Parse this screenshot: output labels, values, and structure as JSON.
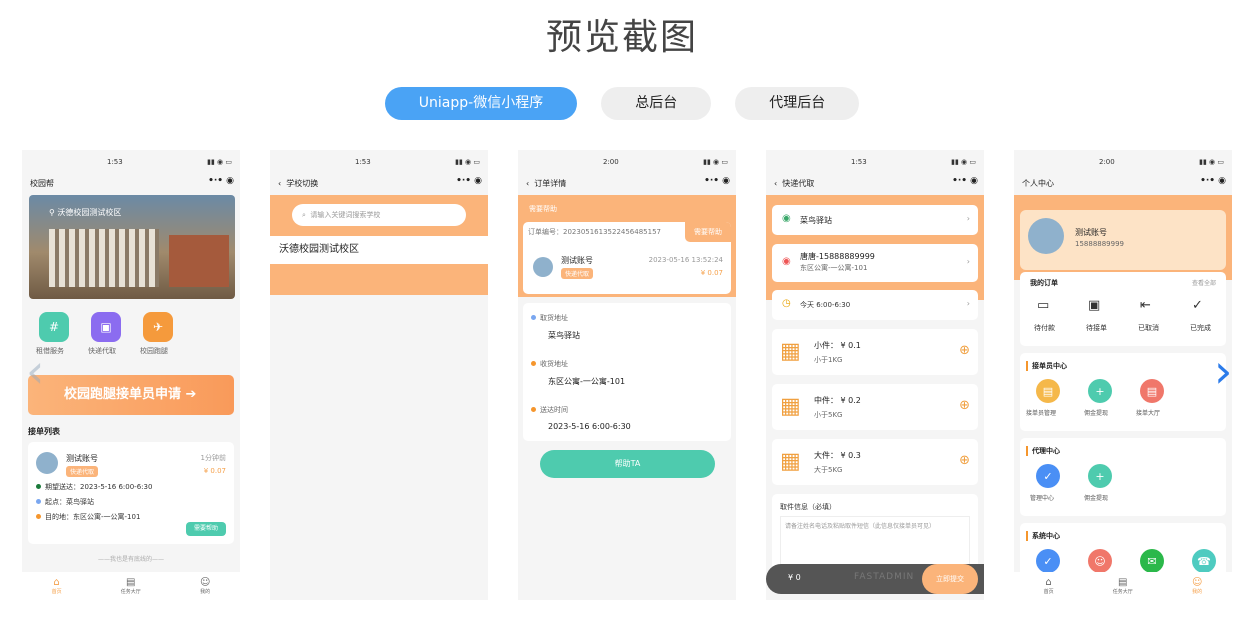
{
  "heading": "预览截图",
  "tabs": [
    "Uniapp-微信小程序",
    "总后台",
    "代理后台"
  ],
  "status": {
    "p1": "1:53",
    "p2": "1:53",
    "p3": "2:00",
    "p4": "1:53",
    "p5": "2:00"
  },
  "p1": {
    "nav": "校园帮",
    "banner_location": "沃德校园测试校区",
    "services": [
      "租借服务",
      "快递代取",
      "校园跑腿"
    ],
    "apply": "校园跑腿接单员申请",
    "list_title": "接单列表",
    "order": {
      "name": "测试账号",
      "time": "1分钟前",
      "tag": "快递代取",
      "price": "¥ 0.07",
      "expect": "期望送达：2023-5-16 6:00-6:30",
      "from": "起点：菜鸟驿站",
      "to": "目的地：东区公寓-一公寓-101",
      "btn": "需要帮助"
    },
    "bottom_note": "——我也是有底线的——",
    "tabbar": [
      "首页",
      "任务大厅",
      "我的"
    ]
  },
  "p2": {
    "nav": "学校切换",
    "search_placeholder": "请输入关键词搜索学校",
    "school": "沃德校园测试校区"
  },
  "p3": {
    "nav": "订单详情",
    "status": "需要帮助",
    "order_no": "订单编号：20230516135224564851​57",
    "order_badge": "需要帮助",
    "name": "测试账号",
    "time": "2023-05-16 13:52:24",
    "tag": "快递代取",
    "price": "¥ 0.07",
    "pickup_label": "取货地址",
    "pickup": "菜鸟驿站",
    "receive_label": "收货地址",
    "receive": "东区公寓-一公寓-101",
    "time_label": "送达时间",
    "deliver": "2023-5-16 6:00-6:30",
    "btn": "帮助TA"
  },
  "p4": {
    "nav": "快递代取",
    "station": "菜鸟驿站",
    "contact": "唐唐-15888889999",
    "address": "东区公寓-一公寓-101",
    "time": "今天 6:00-6:30",
    "items": [
      {
        "name": "小件：  ¥ 0.1",
        "desc": "小于1KG"
      },
      {
        "name": "中件：  ¥ 0.2",
        "desc": "小于5KG"
      },
      {
        "name": "大件：  ¥ 0.3",
        "desc": "大于5KG"
      }
    ],
    "info_label": "取件信息（必填）",
    "info_placeholder": "请备注姓名电话及粘贴取件短信（此信息仅接单员可见）",
    "total": "¥ 0",
    "submit": "立即提交",
    "watermark": "FASTADMIN"
  },
  "p5": {
    "nav": "个人中心",
    "name": "测试账号",
    "phone": "15888889999",
    "orders_title": "我的订单",
    "view_all": "查看全部",
    "order_items": [
      "待付款",
      "待接单",
      "已取消",
      "已完成"
    ],
    "section1": "接单员中心",
    "section1_items": [
      "接单员管理",
      "佣金提现",
      "接单大厅"
    ],
    "section2": "代理中心",
    "section2_items": [
      "管理中心",
      "佣金提现"
    ],
    "section3": "系统中心",
    "tabbar": [
      "首页",
      "任务大厅",
      "我的"
    ]
  },
  "colors": {
    "accent": "#4aa3f5",
    "orange": "#fbb47a",
    "green": "#4ecbae"
  }
}
